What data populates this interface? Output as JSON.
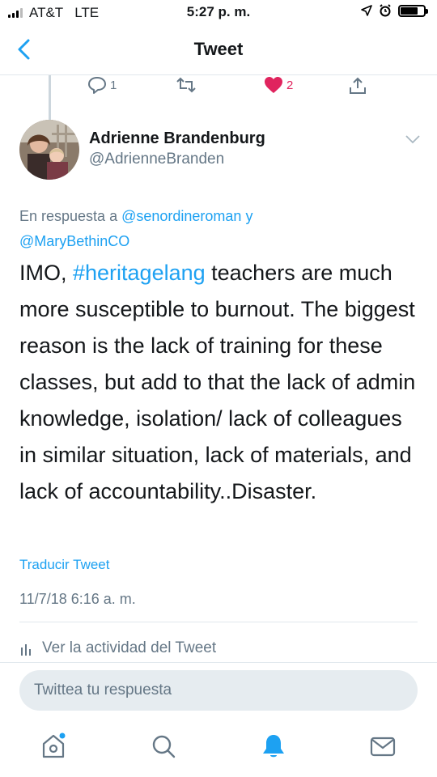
{
  "status_bar": {
    "carrier": "AT&T",
    "network": "LTE",
    "time": "5:27 p. m.",
    "battery_level": 0.8
  },
  "nav": {
    "title": "Tweet",
    "back_icon": "chevron-left-icon"
  },
  "parent_actions": {
    "reply_count": "1",
    "retweet_count": "",
    "like_count": "2",
    "liked": true
  },
  "author": {
    "name": "Adrienne Brandenburg",
    "handle": "@AdrienneBranden"
  },
  "reply_context": {
    "prefix": "En respuesta a",
    "mention1": "@senordineroman",
    "conjunction": "y",
    "mention2": "@MaryBethinCO"
  },
  "tweet": {
    "lead": "IMO, ",
    "hashtag": "#heritagelang",
    "rest": " teachers are much more susceptible to burnout. The biggest reason is the lack of training for these classes, but add to that the lack of admin knowledge, isolation/ lack of colleagues in similar situation, lack of materials, and lack of accountability..Disaster.",
    "translate_label": "Traducir Tweet",
    "timestamp": "11/7/18 6:16 a. m.",
    "activity_label": "Ver la actividad del Tweet"
  },
  "compose": {
    "placeholder": "Twittea tu respuesta"
  },
  "colors": {
    "accent": "#1da1f2",
    "like": "#e0245e",
    "secondary_text": "#657786"
  }
}
